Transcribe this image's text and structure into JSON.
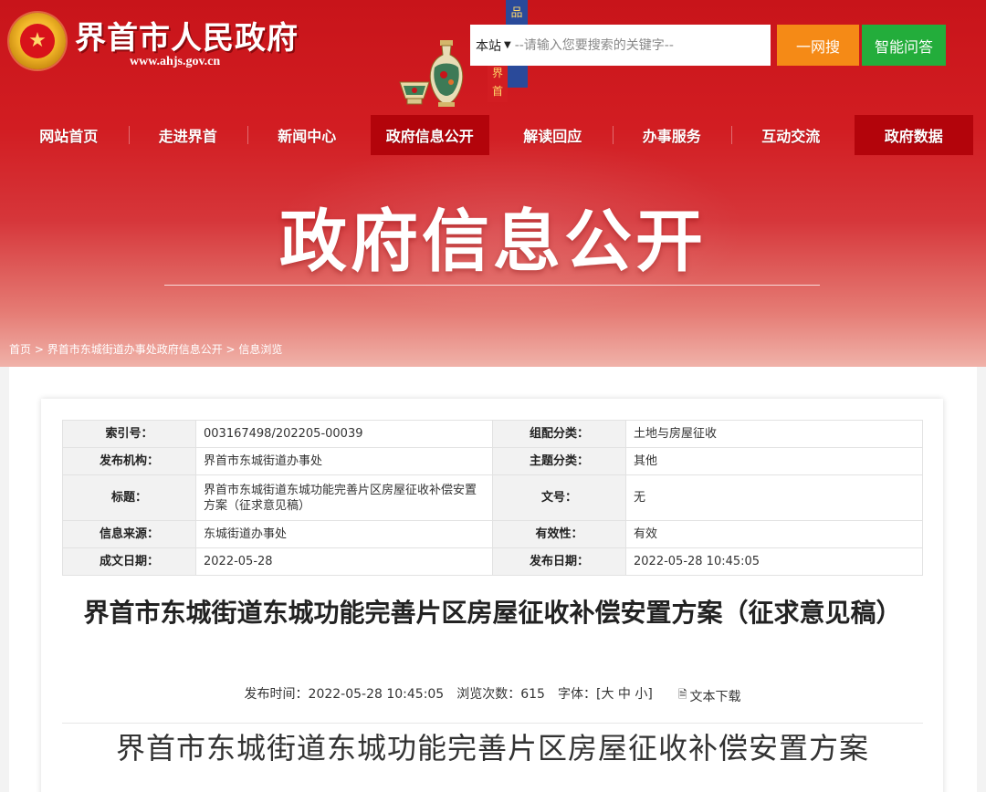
{
  "header": {
    "site_title": "界首市人民政府",
    "site_url": "www.ahjs.gov.cn",
    "scroll_text": "品 界首"
  },
  "search": {
    "scope": "本站",
    "placeholder": "--请输入您要搜索的关键字--",
    "search_button": "一网搜",
    "qa_button": "智能问答"
  },
  "nav": {
    "items": [
      "网站首页",
      "走进界首",
      "新闻中心",
      "政府信息公开",
      "解读回应",
      "办事服务",
      "互动交流",
      "政府数据"
    ],
    "active_index": 3
  },
  "banner": {
    "heading": "政府信息公开"
  },
  "breadcrumb": {
    "items": [
      "首页",
      "界首市东城街道办事处政府信息公开",
      "信息浏览"
    ],
    "separator": " > "
  },
  "meta_table": {
    "index_label": "索引号：",
    "index_value": "003167498/202205-00039",
    "category_label": "组配分类：",
    "category_value": "土地与房屋征收",
    "publisher_label": "发布机构：",
    "publisher_value": "界首市东城街道办事处",
    "topic_label": "主题分类：",
    "topic_value": "其他",
    "title_label": "标题：",
    "title_value": "界首市东城街道东城功能完善片区房屋征收补偿安置方案（征求意见稿）",
    "docno_label": "文号：",
    "docno_value": "无",
    "source_label": "信息来源：",
    "source_value": "东城街道办事处",
    "validity_label": "有效性：",
    "validity_value": "有效",
    "created_label": "成文日期：",
    "created_value": "2022-05-28",
    "published_label": "发布日期：",
    "published_value": "2022-05-28 10:45:05"
  },
  "article": {
    "title": "界首市东城街道东城功能完善片区房屋征收补偿安置方案（征求意见稿）",
    "publish_time": "发布时间：2022-05-28 10:45:05",
    "views": "浏览次数：615",
    "font_label": "字体：[",
    "font_large": "大",
    "font_medium": "中",
    "font_small": "小",
    "font_close": "]",
    "download": "文本下载",
    "body_heading": "界首市东城街道东城功能完善片区房屋征收补偿安置方案"
  },
  "colors": {
    "primary_red": "#c8141a",
    "nav_active": "#b3040b",
    "search_orange": "#f58a16",
    "qa_green": "#23ad3b"
  }
}
